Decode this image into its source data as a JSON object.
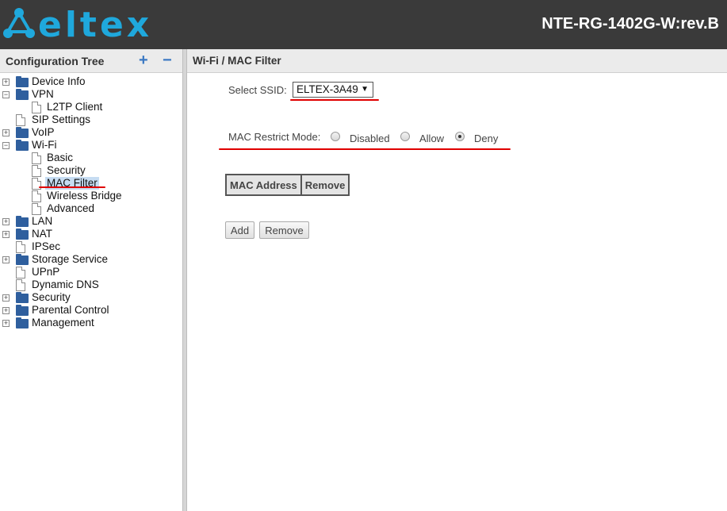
{
  "header": {
    "brand": "eltex",
    "model": "NTE-RG-1402G-W:rev.B"
  },
  "sidebar": {
    "title": "Configuration Tree",
    "expand_symbol": "+",
    "collapse_symbol": "−",
    "items": [
      {
        "label": "Device Info",
        "toggle": "+"
      },
      {
        "label": "VPN",
        "toggle": "−"
      },
      {
        "label": "L2TP Client"
      },
      {
        "label": "SIP Settings"
      },
      {
        "label": "VoIP",
        "toggle": "+"
      },
      {
        "label": "Wi-Fi",
        "toggle": "−"
      },
      {
        "label": "Basic"
      },
      {
        "label": "Security"
      },
      {
        "label": "MAC Filter"
      },
      {
        "label": "Wireless Bridge"
      },
      {
        "label": "Advanced"
      },
      {
        "label": "LAN",
        "toggle": "+"
      },
      {
        "label": "NAT",
        "toggle": "+"
      },
      {
        "label": "IPSec"
      },
      {
        "label": "Storage Service",
        "toggle": "+"
      },
      {
        "label": "UPnP"
      },
      {
        "label": "Dynamic DNS"
      },
      {
        "label": "Security",
        "toggle": "+"
      },
      {
        "label": "Parental Control",
        "toggle": "+"
      },
      {
        "label": "Management",
        "toggle": "+"
      }
    ]
  },
  "main": {
    "breadcrumb": "Wi-Fi / MAC Filter",
    "ssid_label": "Select SSID:",
    "ssid_value": "ELTEX-3A49",
    "ssid_arrow": "▼",
    "mode_label": "MAC Restrict Mode:",
    "modes": [
      "Disabled",
      "Allow",
      "Deny"
    ],
    "selected_mode": "Deny",
    "table_headers": [
      "MAC Address",
      "Remove"
    ],
    "buttons": {
      "add": "Add",
      "remove": "Remove"
    }
  },
  "colors": {
    "brand": "#1fa8dc",
    "header_bg": "#3a3a3a",
    "annotation_red": "#e00000",
    "selection": "#c6dcf2"
  }
}
